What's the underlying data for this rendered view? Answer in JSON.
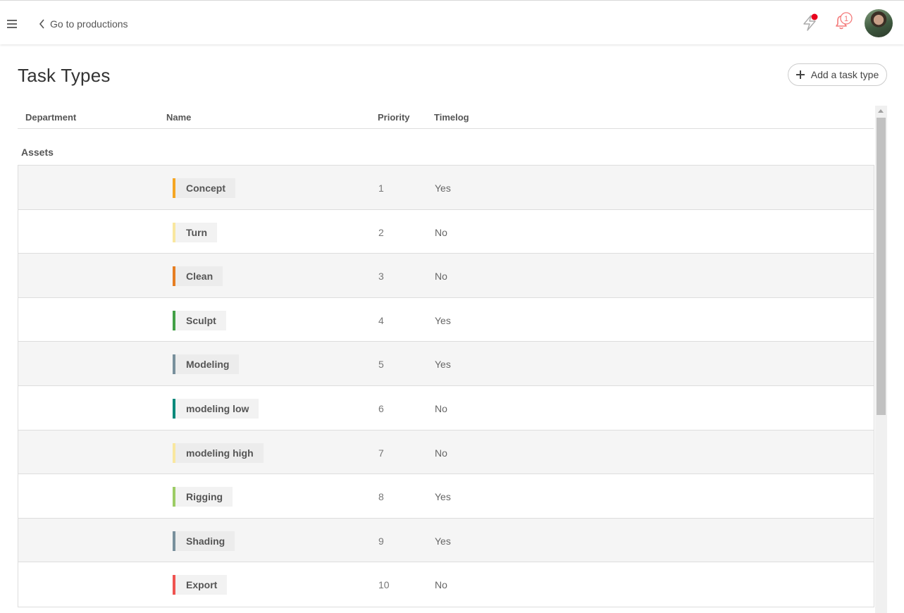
{
  "topbar": {
    "back_label": "Go to productions",
    "notification_count": "1",
    "colors": {
      "bolt_dot": "#e8001c",
      "bell": "#f47a7a"
    }
  },
  "page": {
    "title": "Task Types",
    "add_button_label": "Add a task type"
  },
  "table": {
    "columns": [
      "Department",
      "Name",
      "Priority",
      "Timelog"
    ],
    "group": "Assets",
    "rows": [
      {
        "name": "Concept",
        "priority": "1",
        "timelog": "Yes",
        "color": "#f5a623"
      },
      {
        "name": "Turn",
        "priority": "2",
        "timelog": "No",
        "color": "#f9e79f"
      },
      {
        "name": "Clean",
        "priority": "3",
        "timelog": "No",
        "color": "#e67e22"
      },
      {
        "name": "Sculpt",
        "priority": "4",
        "timelog": "Yes",
        "color": "#43a047"
      },
      {
        "name": "Modeling",
        "priority": "5",
        "timelog": "Yes",
        "color": "#78909c"
      },
      {
        "name": "modeling low",
        "priority": "6",
        "timelog": "No",
        "color": "#00897b"
      },
      {
        "name": "modeling high",
        "priority": "7",
        "timelog": "No",
        "color": "#f9e79f"
      },
      {
        "name": "Rigging",
        "priority": "8",
        "timelog": "Yes",
        "color": "#9ccc65"
      },
      {
        "name": "Shading",
        "priority": "9",
        "timelog": "Yes",
        "color": "#78909c"
      },
      {
        "name": "Export",
        "priority": "10",
        "timelog": "No",
        "color": "#ef5350"
      }
    ]
  }
}
